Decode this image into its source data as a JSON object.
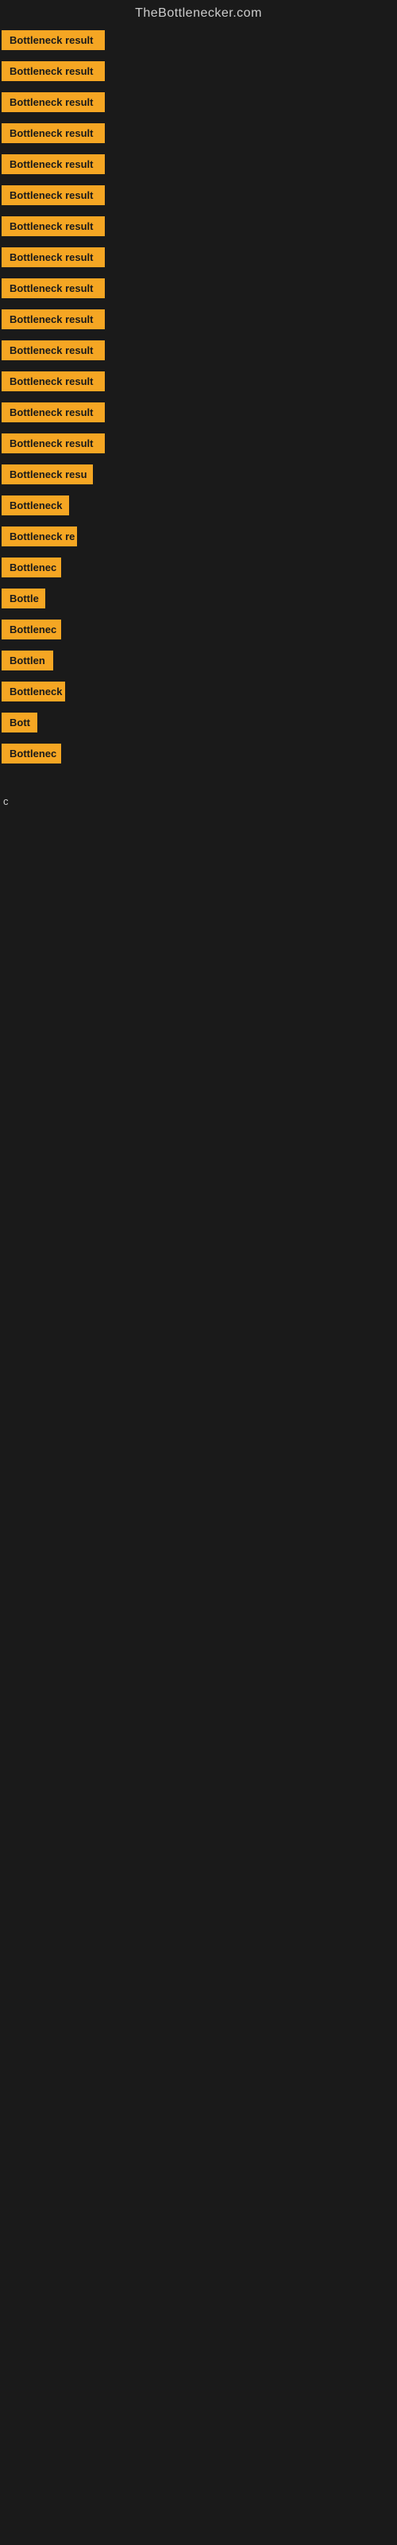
{
  "site_title": "TheBottlenecker.com",
  "items": [
    {
      "id": 1,
      "label": "Bottleneck result",
      "width": 130
    },
    {
      "id": 2,
      "label": "Bottleneck result",
      "width": 130
    },
    {
      "id": 3,
      "label": "Bottleneck result",
      "width": 130
    },
    {
      "id": 4,
      "label": "Bottleneck result",
      "width": 130
    },
    {
      "id": 5,
      "label": "Bottleneck result",
      "width": 130
    },
    {
      "id": 6,
      "label": "Bottleneck result",
      "width": 130
    },
    {
      "id": 7,
      "label": "Bottleneck result",
      "width": 130
    },
    {
      "id": 8,
      "label": "Bottleneck result",
      "width": 130
    },
    {
      "id": 9,
      "label": "Bottleneck result",
      "width": 130
    },
    {
      "id": 10,
      "label": "Bottleneck result",
      "width": 130
    },
    {
      "id": 11,
      "label": "Bottleneck result",
      "width": 130
    },
    {
      "id": 12,
      "label": "Bottleneck result",
      "width": 130
    },
    {
      "id": 13,
      "label": "Bottleneck result",
      "width": 130
    },
    {
      "id": 14,
      "label": "Bottleneck result",
      "width": 130
    },
    {
      "id": 15,
      "label": "Bottleneck resu",
      "width": 115
    },
    {
      "id": 16,
      "label": "Bottleneck",
      "width": 85
    },
    {
      "id": 17,
      "label": "Bottleneck re",
      "width": 95
    },
    {
      "id": 18,
      "label": "Bottlenec",
      "width": 75
    },
    {
      "id": 19,
      "label": "Bottle",
      "width": 55
    },
    {
      "id": 20,
      "label": "Bottlenec",
      "width": 75
    },
    {
      "id": 21,
      "label": "Bottlen",
      "width": 65
    },
    {
      "id": 22,
      "label": "Bottleneck",
      "width": 80
    },
    {
      "id": 23,
      "label": "Bott",
      "width": 45
    },
    {
      "id": 24,
      "label": "Bottlenec",
      "width": 75
    }
  ],
  "small_char": "c"
}
